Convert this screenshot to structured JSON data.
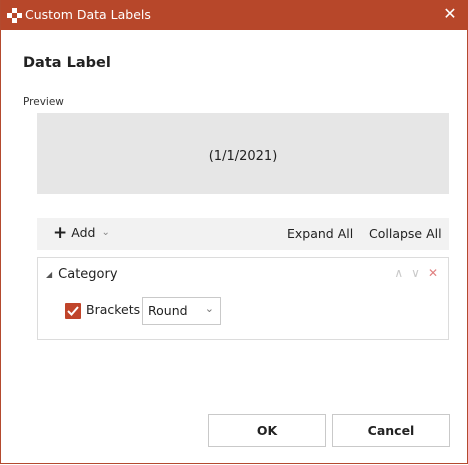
{
  "window": {
    "title": "Custom Data Labels",
    "close_icon": "close-icon",
    "accent_color": "#b7472a"
  },
  "heading": "Data Label",
  "preview": {
    "label": "Preview",
    "text": "(1/1/2021)"
  },
  "toolbar": {
    "add_label": "Add",
    "expand_all_label": "Expand All",
    "collapse_all_label": "Collapse All"
  },
  "category": {
    "label": "Category",
    "brackets_label": "Brackets",
    "brackets_checked": true,
    "bracket_style_value": "Round"
  },
  "buttons": {
    "ok_label": "OK",
    "cancel_label": "Cancel"
  }
}
